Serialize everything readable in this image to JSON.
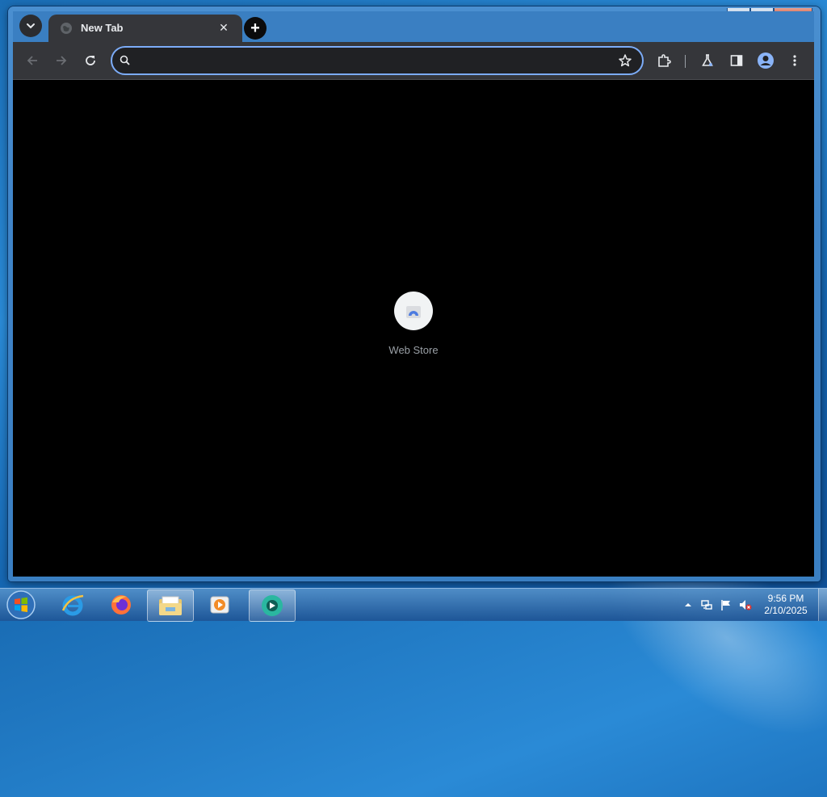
{
  "browser": {
    "tab": {
      "title": "New Tab",
      "close_glyph": "✕"
    },
    "new_tab_glyph": "+",
    "window_controls": {
      "minimize": "—",
      "maximize": "□",
      "close": "✕"
    },
    "omnibox": {
      "value": "",
      "placeholder": ""
    },
    "toolbar_icons": [
      "back-icon",
      "forward-icon",
      "reload-icon",
      "search-icon",
      "bookmark-star-icon",
      "extensions-icon",
      "labs-flask-icon",
      "side-panel-icon",
      "profile-icon",
      "menu-icon"
    ]
  },
  "new_tab_page": {
    "shortcuts": [
      {
        "label": "Web Store",
        "icon": "web-store-icon"
      }
    ]
  },
  "taskbar": {
    "pinned": [
      "internet-explorer-icon",
      "firefox-icon",
      "file-explorer-icon",
      "media-player-icon",
      "chrome-app-icon"
    ],
    "tray_icons": [
      "show-hidden-icons-arrow",
      "network-icon",
      "action-center-flag-icon",
      "volume-muted-icon"
    ],
    "clock": {
      "time": "9:56 PM",
      "date": "2/10/2025"
    }
  },
  "colors": {
    "omnibox_focus": "#7cacf8",
    "titlebar": "#3a7fc2",
    "toolbar": "#35363a",
    "page_bg": "#000000",
    "close_button": "#c2371a"
  }
}
